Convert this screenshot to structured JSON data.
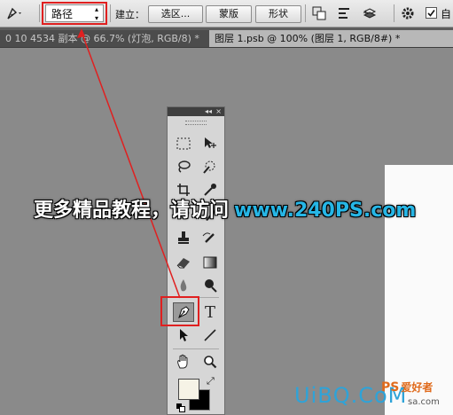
{
  "options_bar": {
    "mode_select_value": "路径",
    "make_label": "建立：",
    "selection_button": "选区...",
    "mask_button": "蒙版",
    "shape_button": "形状",
    "auto_add_label": "自"
  },
  "tabs": [
    {
      "label": "0 10 4534 副本 @ 66.7% (灯泡, RGB/8) *",
      "close": "×"
    },
    {
      "label": "图层 1.psb @ 100% (图层 1, RGB/8#) *",
      "close": "×"
    }
  ],
  "toolbox": {
    "header": "◂◂",
    "collapse": "×",
    "type_tool": "T"
  },
  "banner": {
    "text": "更多精品教程，请访问",
    "url": "www.240PS.com"
  },
  "watermark": {
    "logo": "UiBQ.CoM",
    "ps": "PS",
    "brand": "爱好者",
    "site": "sa.com"
  },
  "colors": {
    "highlight": "#e02020",
    "url": "#26b6e6",
    "foreground_swatch": "#f6f3e6",
    "background_swatch": "#000000"
  }
}
